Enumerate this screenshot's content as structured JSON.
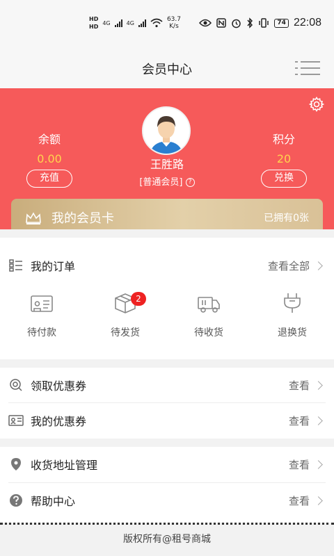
{
  "status_bar": {
    "hd1": "HD",
    "hd2": "HD",
    "net1": "4G",
    "net2": "4G",
    "speed_value": "63.7",
    "speed_unit": "K/s",
    "battery": "74",
    "time": "22:08"
  },
  "header": {
    "title": "会员中心"
  },
  "member": {
    "balance_label": "余额",
    "balance_value": "0.00",
    "recharge_label": "充值",
    "points_label": "积分",
    "points_value": "20",
    "exchange_label": "兑换",
    "username": "王胜路",
    "level": "[普通会员]",
    "help_mark": "?",
    "card_title": "我的会员卡",
    "card_status": "已拥有0张"
  },
  "orders": {
    "title": "我的订单",
    "view_all": "查看全部",
    "items": [
      {
        "label": "待付款"
      },
      {
        "label": "待发货",
        "badge": "2"
      },
      {
        "label": "待收货"
      },
      {
        "label": "退换货"
      }
    ]
  },
  "coupons": {
    "get_label": "领取优惠券",
    "mine_label": "我的优惠券",
    "view": "查看"
  },
  "service": {
    "address_label": "收货地址管理",
    "help_label": "帮助中心",
    "view": "查看"
  },
  "footer": {
    "copyright": "版权所有@租号商城"
  },
  "colors": {
    "banner": "#f65a5a",
    "accent_value": "#ffd44d",
    "badge": "#e22222",
    "card_gold": "#d4bb8c"
  },
  "icons": {
    "settings": "gear-icon",
    "menu": "list-menu-icon",
    "orders": "order-list-icon",
    "pay": "wallet-card-icon",
    "ship": "package-box-icon",
    "receive": "truck-icon",
    "return": "plug-exchange-icon",
    "get_coupon": "coupon-search-icon",
    "my_coupon": "coupon-card-icon",
    "address": "location-pin-icon",
    "help": "question-circle-icon"
  }
}
